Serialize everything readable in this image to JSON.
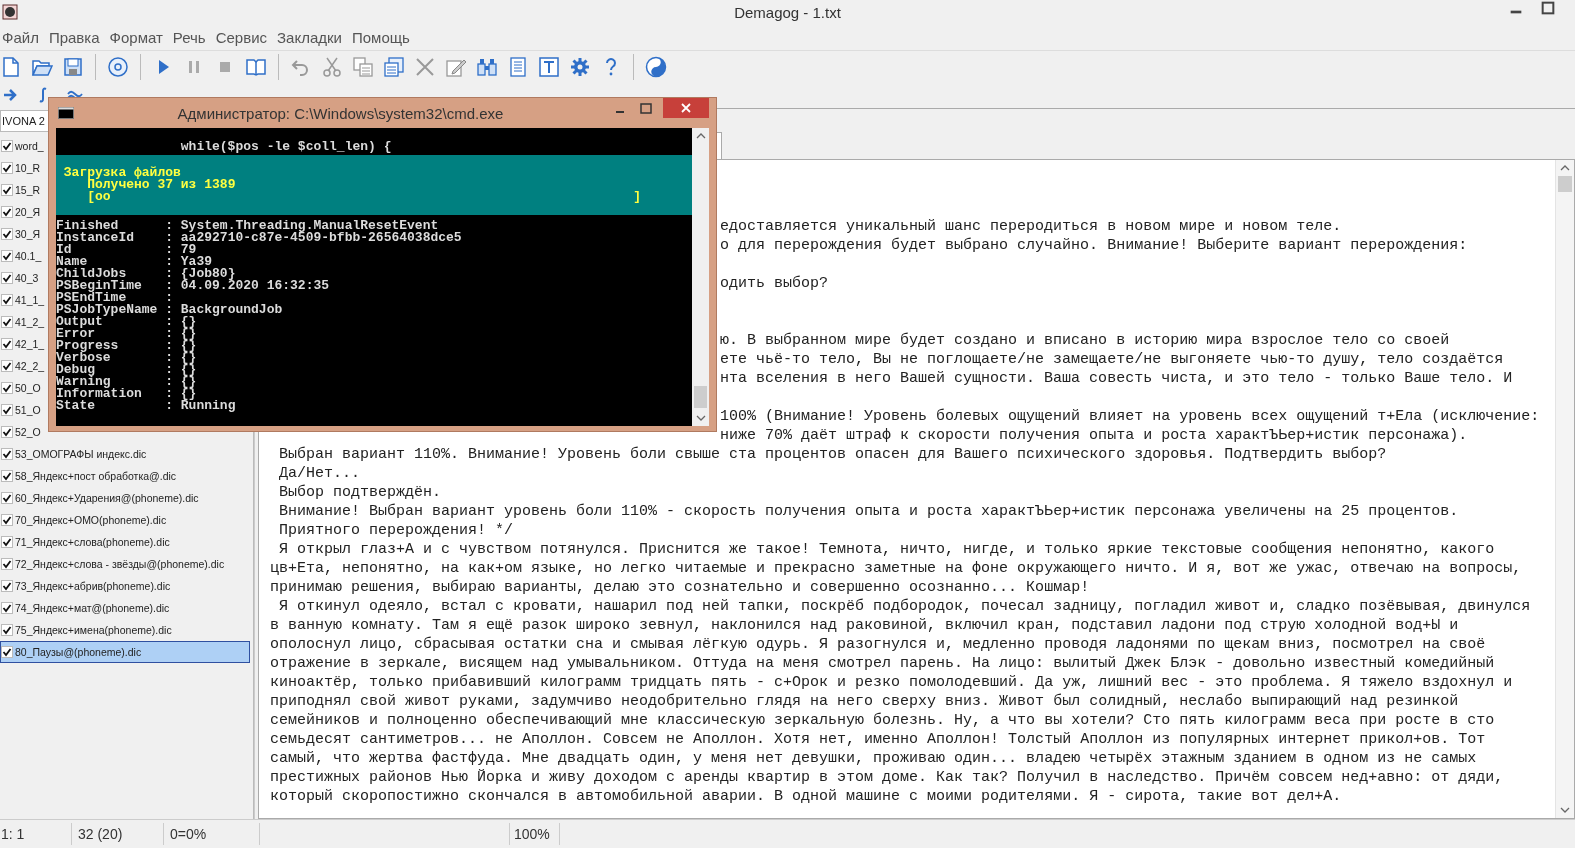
{
  "window": {
    "title": "Demagog - 1.txt"
  },
  "menu": [
    "Файл",
    "Правка",
    "Формат",
    "Речь",
    "Сервис",
    "Закладки",
    "Помощь"
  ],
  "voice_select": {
    "value": "IVONA 2"
  },
  "dictionaries": [
    {
      "label": "word_",
      "checked": true,
      "selected": false
    },
    {
      "label": "10_R",
      "checked": true,
      "selected": false
    },
    {
      "label": "15_R",
      "checked": true,
      "selected": false
    },
    {
      "label": "20_Я",
      "checked": true,
      "selected": false
    },
    {
      "label": "30_Я",
      "checked": true,
      "selected": false
    },
    {
      "label": "40.1_",
      "checked": true,
      "selected": false
    },
    {
      "label": "40_3",
      "checked": true,
      "selected": false
    },
    {
      "label": "41_1_",
      "checked": true,
      "selected": false
    },
    {
      "label": "41_2_",
      "checked": true,
      "selected": false
    },
    {
      "label": "42_1_",
      "checked": true,
      "selected": false
    },
    {
      "label": "42_2_",
      "checked": true,
      "selected": false
    },
    {
      "label": "50_О",
      "checked": true,
      "selected": false
    },
    {
      "label": "51_О",
      "checked": true,
      "selected": false
    },
    {
      "label": "52_О",
      "checked": true,
      "selected": false
    },
    {
      "label": "53_ОМОГРАФЫ индекс.dic",
      "checked": true,
      "selected": false
    },
    {
      "label": "58_Яндекс+пост обработка@.dic",
      "checked": true,
      "selected": false
    },
    {
      "label": "60_Яндекс+Ударения@(phoneme).dic",
      "checked": true,
      "selected": false
    },
    {
      "label": "70_Яндекс+ОМО(phoneme).dic",
      "checked": true,
      "selected": false
    },
    {
      "label": "71_Яндекс+слова(phoneme).dic",
      "checked": true,
      "selected": false
    },
    {
      "label": "72_Яндекс+слова - звёзды@(phoneme).dic",
      "checked": true,
      "selected": false
    },
    {
      "label": "73_Яндекс+абрив(phoneme).dic",
      "checked": true,
      "selected": false
    },
    {
      "label": "74_Яндекс+мат@(phoneme).dic",
      "checked": true,
      "selected": false
    },
    {
      "label": "75_Яндекс+имена(phoneme).dic",
      "checked": true,
      "selected": false
    },
    {
      "label": "80_Паузы@(phoneme).dic",
      "checked": true,
      "selected": true
    }
  ],
  "editor": {
    "fragments": [
      {
        "text": "едоставляется уникальный шанс переродиться в новом мире и новом теле."
      },
      {
        "text": "о для перерождения будет выбрано случайно. Внимание! Выберите вариант перерождения:"
      },
      {
        "text": "одить выбор?"
      },
      {
        "text": "ю. В выбранном мире будет создано и вписано в историю мира взрослое тело со своей"
      },
      {
        "text": "ете чьё-то тело, Вы не поглощаете/не замещаете/не выгоняете чью-то душу, тело создаётся"
      },
      {
        "text": "нта вселения в него Вашей сущности. Ваша совесть чиста, и это тело - только Ваше тело. И"
      },
      {
        "text": "100% (Внимание! Уровень болевых ощущений влияет на уровень всех ощущений т+Ела (исключение:"
      },
      {
        "text": "ниже 70% даёт штраф к скорости получения опыта и роста характЪЬер+истик персонажа)."
      }
    ],
    "lines": [
      {
        "text": "Выбран вариант 110%. Внимание! Уровень боли свыше ста процентов опасен для Вашего психического здоровья. Подтвердить выбор?",
        "indent": true
      },
      {
        "text": "Да/Нет...",
        "indent": true
      },
      {
        "text": "Выбор подтверждён.",
        "indent": true
      },
      {
        "text": "Внимание! Выбран вариант уровень боли 110% - скорость получения опыта и роста характЪЬер+истик персонажа увеличены на 25 процентов.",
        "indent": true
      },
      {
        "text": "Приятного перерождения! */",
        "indent": true
      },
      {
        "text": "Я открыл глаз+А и с чувством потянулся. Приснится же такое! Темнота, ничто, нигде, и только яркие текстовые сообщения непонятно, какого",
        "indent": true
      },
      {
        "text": "цв+Ета, непонятно, на как+ом языке, но легко читаемые и прекрасно заметные на фоне окружающего ничто. И я, вот же ужас, отвечаю на вопросы,",
        "indent": false
      },
      {
        "text": "принимаю решения, выбираю варианты, делаю это сознательно и совершенно осознанно... Кошмар!",
        "indent": false
      },
      {
        "text": "Я откинул одеяло, встал с кровати, нашарил под ней тапки, поскрёб подбородок, почесал задницу, погладил живот и, сладко позёвывая, двинулся",
        "indent": true
      },
      {
        "text": "в ванную комнату. Там я ещё разок широко зевнул, наклонился над раковиной, включил кран, подставил ладони под струю холодной вод+Ы и",
        "indent": false
      },
      {
        "text": "ополоснул лицо, сбрасывая остатки сна и смывая лёгкую одурь. Я разогнулся и, медленно проводя ладонями по щекам вниз, посмотрел на своё",
        "indent": false
      },
      {
        "text": "отражение в зеркале, висящем над умывальником. Оттуда на меня смотрел парень. На лицо: вылитый Джек Блэк - довольно известный комедийный",
        "indent": false
      },
      {
        "text": "киноактёр, только прибавивший килограмм тридцать пять - с+Орок и резко помолодевший. Да уж, лишний вес - это проблема. Я тяжело вздохнул и",
        "indent": false
      },
      {
        "text": "приподнял свой живот руками, задумчиво неодобрительно глядя на него сверху вниз. Живот был солидный, неслабо выпирающий над резинкой",
        "indent": false
      },
      {
        "text": "семейников и полноценно обеспечивающий мне классическую зеркальную болезнь. Ну, а что вы хотели? Сто пять килограмм веса при росте в сто",
        "indent": false
      },
      {
        "text": "семьдесят сантиметров... не Аполлон. Совсем не Аполлон. Хотя нет, именно Аполлон! Толстый Аполлон из популярных интернет прикол+ов. Тот",
        "indent": false
      },
      {
        "text": "самый, что жертва фастфуда. Мне двадцать один, у меня нет девушки, проживаю один... владею четырёх этажным зданием в одном из не самых",
        "indent": false
      },
      {
        "text": "престижных районов Нью Йорка и живу доходом с аренды квартир в этом доме. Как так? Получил в наследство. Причём совсем нед+авно: от дяди,",
        "indent": false
      },
      {
        "text": "который скоропостижно скончался в автомобильной аварии. В одной машине с моими родителями. Я - сирота, такие вот дел+А.",
        "indent": false
      }
    ]
  },
  "status_bar": {
    "position": "1: 1",
    "count": "32 (20)",
    "ratio": "0=0%",
    "zoom": "100%"
  },
  "console": {
    "title": "Администратор: C:\\Windows\\system32\\cmd.exe",
    "command": "while($pos -le $coll_len) {",
    "progress": {
      "title": "Загрузка файлов",
      "status": "Получено 37 из 1389",
      "bar_start": "[oo",
      "bar_end": "]"
    },
    "lines": [
      "Finished      : System.Threading.ManualResetEvent",
      "InstanceId    : aa292710-c87e-4509-bfbb-26564038dce5",
      "Id            : 79",
      "Name          : Ya39",
      "ChildJobs     : {Job80}",
      "PSBeginTime   : 04.09.2020 16:32:35",
      "PSEndTime     :",
      "PSJobTypeName : BackgroundJob",
      "Output        : {}",
      "Error         : {}",
      "Progress      : {}",
      "Verbose       : {}",
      "Debug         : {}",
      "Warning       : {}",
      "Information   : {}",
      "State         : Running"
    ]
  }
}
